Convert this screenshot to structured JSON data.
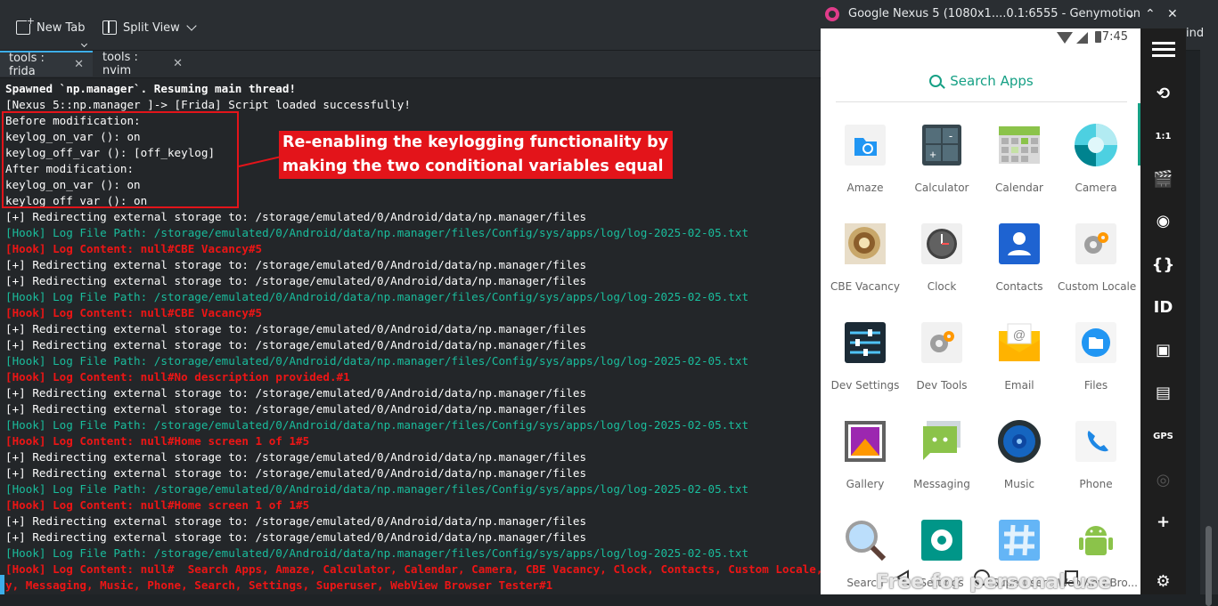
{
  "konsole": {
    "toolbar": {
      "new_tab": "New Tab",
      "split_view": "Split View",
      "find": "ind"
    },
    "tabs": [
      {
        "label": "tools : frida",
        "close": "✕"
      },
      {
        "label": "tools : nvim",
        "close": "✕"
      }
    ],
    "lines": [
      {
        "text": "Spawned `np.manager`. Resuming main thread!",
        "style": "bold"
      },
      {
        "text": "[Nexus 5::np.manager ]-> [Frida] Script loaded successfully!",
        "style": "white"
      },
      {
        "text": "Before modification:",
        "style": "white"
      },
      {
        "text": "keylog_on_var (): on",
        "style": "white"
      },
      {
        "text": "keylog_off_var (): [off_keylog]",
        "style": "white"
      },
      {
        "text": "After modification:",
        "style": "white"
      },
      {
        "text": "keylog_on_var (): on",
        "style": "white"
      },
      {
        "text": "keylog_off_var (): on",
        "style": "white"
      },
      {
        "text": "[+] Redirecting external storage to: /storage/emulated/0/Android/data/np.manager/files",
        "style": "white"
      },
      {
        "text": "[Hook] Log File Path: /storage/emulated/0/Android/data/np.manager/files/Config/sys/apps/log/log-2025-02-05.txt",
        "style": "cyan"
      },
      {
        "text": "[Hook] Log Content: null#CBE Vacancy#5",
        "style": "red"
      },
      {
        "text": "[+] Redirecting external storage to: /storage/emulated/0/Android/data/np.manager/files",
        "style": "white"
      },
      {
        "text": "[+] Redirecting external storage to: /storage/emulated/0/Android/data/np.manager/files",
        "style": "white"
      },
      {
        "text": "[Hook] Log File Path: /storage/emulated/0/Android/data/np.manager/files/Config/sys/apps/log/log-2025-02-05.txt",
        "style": "cyan"
      },
      {
        "text": "[Hook] Log Content: null#CBE Vacancy#5",
        "style": "red"
      },
      {
        "text": "[+] Redirecting external storage to: /storage/emulated/0/Android/data/np.manager/files",
        "style": "white"
      },
      {
        "text": "[+] Redirecting external storage to: /storage/emulated/0/Android/data/np.manager/files",
        "style": "white"
      },
      {
        "text": "[Hook] Log File Path: /storage/emulated/0/Android/data/np.manager/files/Config/sys/apps/log/log-2025-02-05.txt",
        "style": "cyan"
      },
      {
        "text": "[Hook] Log Content: null#No description provided.#1",
        "style": "red"
      },
      {
        "text": "[+] Redirecting external storage to: /storage/emulated/0/Android/data/np.manager/files",
        "style": "white"
      },
      {
        "text": "[+] Redirecting external storage to: /storage/emulated/0/Android/data/np.manager/files",
        "style": "white"
      },
      {
        "text": "[Hook] Log File Path: /storage/emulated/0/Android/data/np.manager/files/Config/sys/apps/log/log-2025-02-05.txt",
        "style": "cyan"
      },
      {
        "text": "[Hook] Log Content: null#Home screen 1 of 1#5",
        "style": "red"
      },
      {
        "text": "[+] Redirecting external storage to: /storage/emulated/0/Android/data/np.manager/files",
        "style": "white"
      },
      {
        "text": "[+] Redirecting external storage to: /storage/emulated/0/Android/data/np.manager/files",
        "style": "white"
      },
      {
        "text": "[Hook] Log File Path: /storage/emulated/0/Android/data/np.manager/files/Config/sys/apps/log/log-2025-02-05.txt",
        "style": "cyan"
      },
      {
        "text": "[Hook] Log Content: null#Home screen 1 of 1#5",
        "style": "red"
      },
      {
        "text": "[+] Redirecting external storage to: /storage/emulated/0/Android/data/np.manager/files",
        "style": "white"
      },
      {
        "text": "[+] Redirecting external storage to: /storage/emulated/0/Android/data/np.manager/files",
        "style": "white"
      },
      {
        "text": "[Hook] Log File Path: /storage/emulated/0/Android/data/np.manager/files/Config/sys/apps/log/log-2025-02-05.txt",
        "style": "cyan"
      },
      {
        "text": "[Hook] Log Content: null#  Search Apps, Amaze, Calculator, Calendar, Camera, CBE Vacancy, Clock, Contacts, Custom Locale, Dev Settings, Dev Tools, Email, Files, Gallery",
        "style": "red"
      },
      {
        "text": "y, Messaging, Music, Phone, Search, Settings, Superuser, WebView Browser Tester#1",
        "style": "red"
      }
    ],
    "annotation": {
      "line1": "Re-enabling the keylogging functionality by",
      "line2": "making the two conditional variables equal"
    }
  },
  "genymotion": {
    "title": "Google Nexus 5 (1080x1....0.1:6555 - Genymotion",
    "status_time": "7:45",
    "search_label": "Search Apps",
    "apps": [
      {
        "label": "Amaze",
        "icon": "folder-search-icon"
      },
      {
        "label": "Calculator",
        "icon": "calculator-icon"
      },
      {
        "label": "Calendar",
        "icon": "calendar-icon"
      },
      {
        "label": "Camera",
        "icon": "camera-icon"
      },
      {
        "label": "CBE Vacancy",
        "icon": "cbe-vacancy-icon"
      },
      {
        "label": "Clock",
        "icon": "clock-icon"
      },
      {
        "label": "Contacts",
        "icon": "contacts-icon"
      },
      {
        "label": "Custom Locale",
        "icon": "gear-icon"
      },
      {
        "label": "Dev Settings",
        "icon": "sliders-icon"
      },
      {
        "label": "Dev Tools",
        "icon": "gear-icon"
      },
      {
        "label": "Email",
        "icon": "email-icon"
      },
      {
        "label": "Files",
        "icon": "files-icon"
      },
      {
        "label": "Gallery",
        "icon": "gallery-icon"
      },
      {
        "label": "Messaging",
        "icon": "messaging-icon"
      },
      {
        "label": "Music",
        "icon": "music-icon"
      },
      {
        "label": "Phone",
        "icon": "phone-icon"
      },
      {
        "label": "Search",
        "icon": "magnifier-icon"
      },
      {
        "label": "Settings",
        "icon": "settings-icon"
      },
      {
        "label": "Superuser",
        "icon": "superuser-icon"
      },
      {
        "label": "WebView Bro...",
        "icon": "android-icon"
      }
    ],
    "watermark": "Free for personal use",
    "sidebar": [
      {
        "name": "menu-icon",
        "glyph": ""
      },
      {
        "name": "rotate-icon",
        "glyph": "⟲"
      },
      {
        "name": "pixel-perfect-icon",
        "glyph": "1:1"
      },
      {
        "name": "capture-icon",
        "glyph": "🎬"
      },
      {
        "name": "rss-icon",
        "glyph": "◉"
      },
      {
        "name": "code-icon",
        "glyph": "{}"
      },
      {
        "name": "id-icon",
        "glyph": "ID"
      },
      {
        "name": "sd-card-icon",
        "glyph": "▣"
      },
      {
        "name": "media-icon",
        "glyph": "▤"
      },
      {
        "name": "gps-icon",
        "glyph": "GPS"
      },
      {
        "name": "fingerprint-icon",
        "glyph": "◎"
      },
      {
        "name": "add-icon",
        "glyph": "+"
      },
      {
        "name": "settings-icon",
        "glyph": "⚙"
      }
    ]
  }
}
